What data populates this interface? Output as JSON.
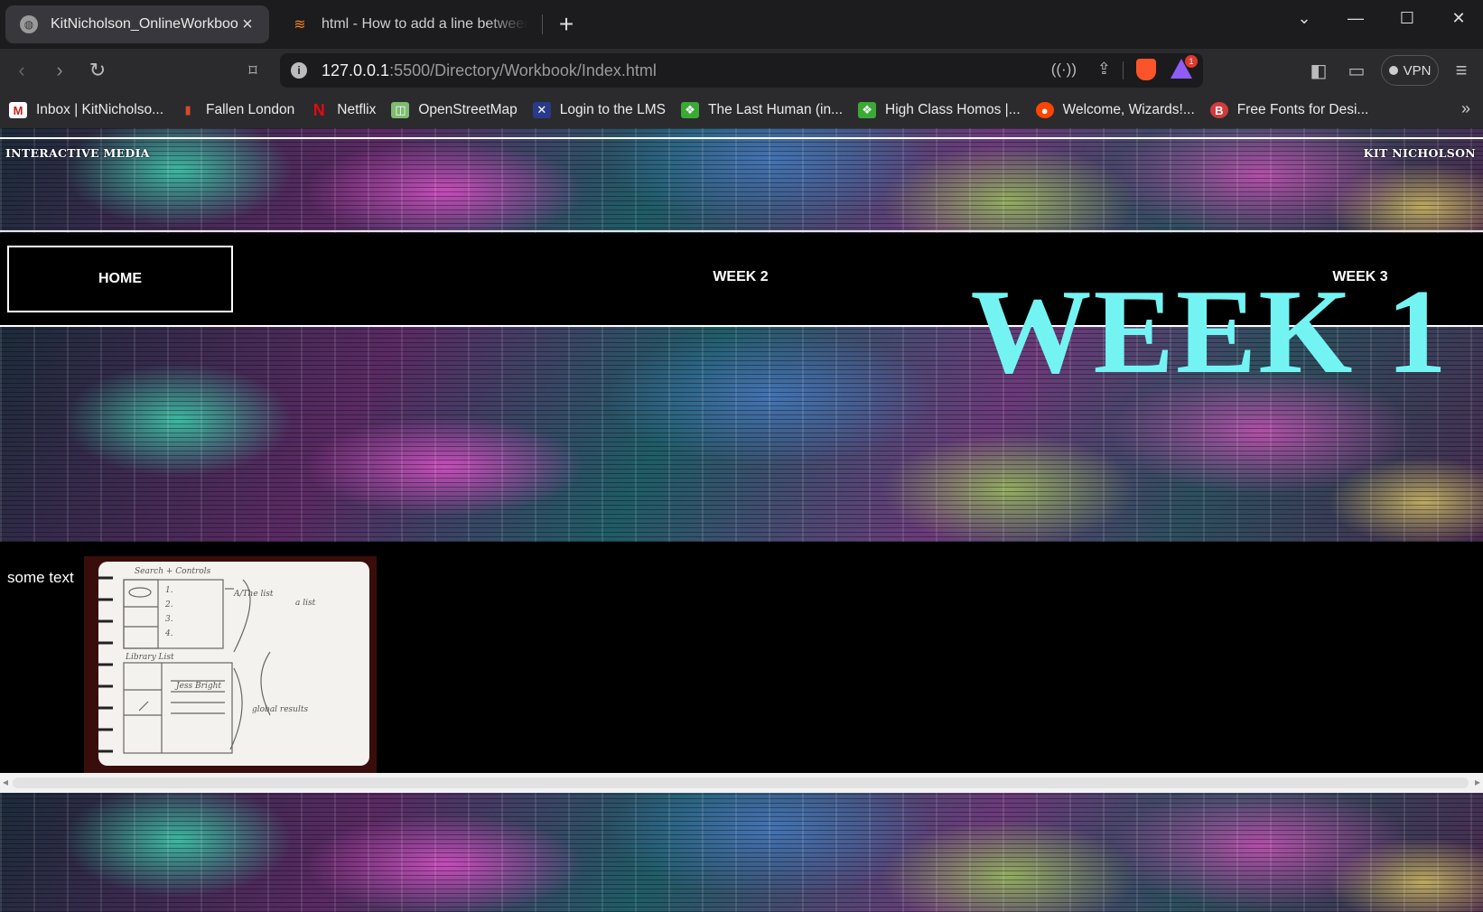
{
  "browser": {
    "tabs": [
      {
        "title": "KitNicholson_OnlineWorkbook",
        "active": true
      },
      {
        "title": "html - How to add a line between fle",
        "active": false
      }
    ],
    "address": {
      "host": "127.0.0.1",
      "path": ":5500/Directory/Workbook/Index.html"
    },
    "vpn_label": "VPN",
    "bookmarks": [
      {
        "label": "Inbox | KitNicholso...",
        "icon": "gmail-icon",
        "color": "#c5221f"
      },
      {
        "label": "Fallen London",
        "icon": "candle-icon",
        "color": "#b02a1f"
      },
      {
        "label": "Netflix",
        "icon": "netflix-icon",
        "color": "#e50914"
      },
      {
        "label": "OpenStreetMap",
        "icon": "map-icon",
        "color": "#7ebc6f"
      },
      {
        "label": "Login to the LMS",
        "icon": "lms-icon",
        "color": "#2a3a8a"
      },
      {
        "label": "The Last Human (in...",
        "icon": "ao3-icon",
        "color": "#3aaa35"
      },
      {
        "label": "High Class Homos |...",
        "icon": "ao3-icon",
        "color": "#3aaa35"
      },
      {
        "label": "Welcome, Wizards!...",
        "icon": "reddit-icon",
        "color": "#ff4500"
      },
      {
        "label": "Free Fonts for Desi...",
        "icon": "b-icon",
        "color": "#d23b3b"
      }
    ]
  },
  "page": {
    "header_left": "INTERACTIVE MEDIA",
    "header_right": "KIT NICHOLSON",
    "nav": {
      "home": "HOME",
      "week2": "WEEK 2",
      "week3": "WEEK 3"
    },
    "hero_title": "WEEK 1",
    "body_text": "some text",
    "sketch_notes": [
      "Search + Controls",
      "1.",
      "2.",
      "3.",
      "4.",
      "A/The list",
      "a list",
      "Library List",
      "Jess Bright",
      "global results"
    ]
  },
  "colors": {
    "hero_title": "#73f4f3",
    "page_bg": "#000000",
    "tabbar_bg": "#1c1c1e",
    "toolbar_bg": "#2b2b2e"
  }
}
